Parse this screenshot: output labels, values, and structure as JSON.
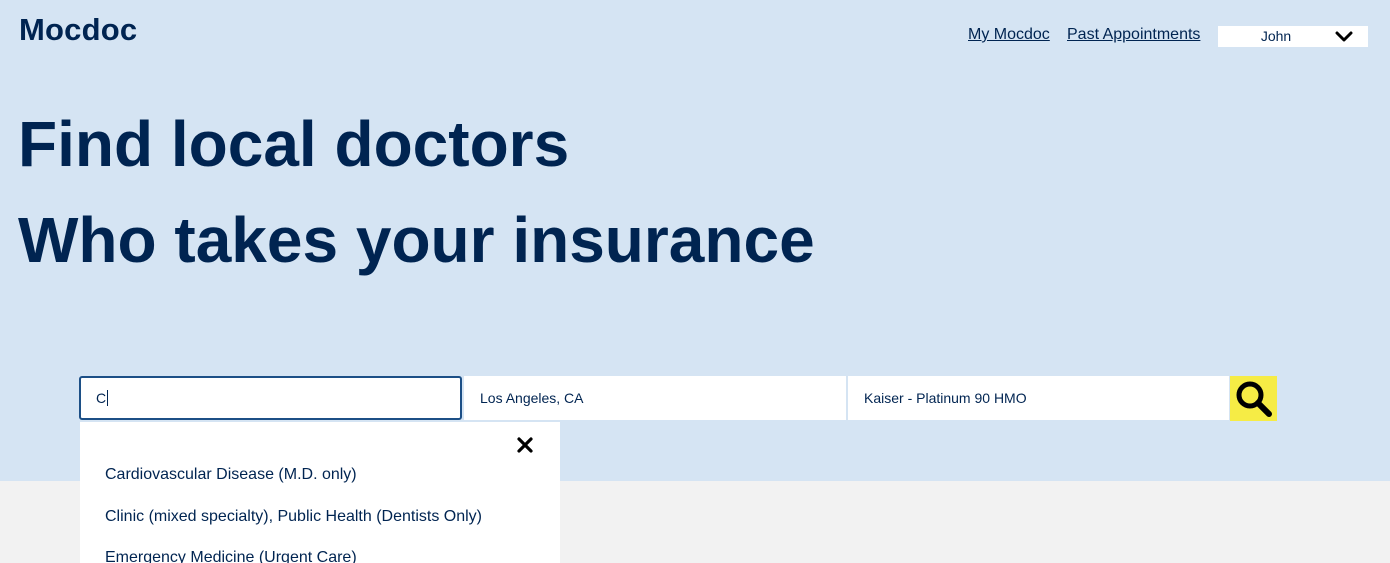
{
  "header": {
    "logo": "Mocdoc",
    "nav": {
      "my_mocdoc": "My Mocdoc",
      "past_appointments": "Past Appointments"
    },
    "user_menu": {
      "selected": "John",
      "icon": "chevron-down-icon"
    }
  },
  "hero": {
    "headline_line1": "Find local doctors",
    "headline_line2": "Who takes your insurance"
  },
  "search": {
    "specialty_value": "C",
    "location_value": "Los Angeles, CA",
    "insurance_value": "Kaiser - Platinum 90 HMO",
    "button_icon": "search-icon"
  },
  "suggestions": {
    "close_icon": "close-icon",
    "items": [
      "Cardiovascular Disease (M.D. only)",
      "Clinic (mixed specialty), Public Health (Dentists Only)",
      "Emergency Medicine (Urgent Care)"
    ]
  },
  "colors": {
    "hero_background": "#d5e4f3",
    "page_background": "#f2f2f2",
    "text_primary": "#002451",
    "search_button": "#f6ec45",
    "input_focus_border": "#1c4f86"
  }
}
